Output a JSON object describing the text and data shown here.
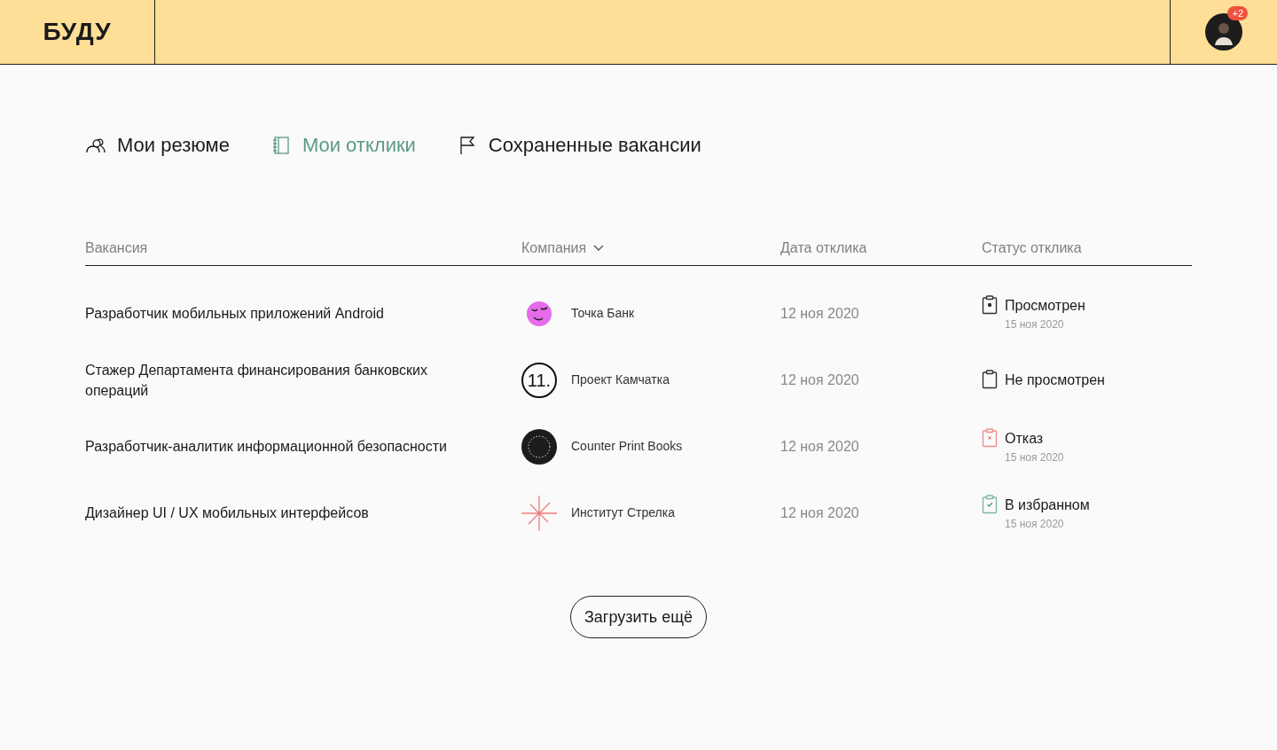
{
  "header": {
    "logo": "БУДУ",
    "avatar": {
      "badge": "+2"
    }
  },
  "tabs": [
    {
      "label": "Мои резюме",
      "kind": "resume",
      "selected": false
    },
    {
      "label": "Мои отклики",
      "kind": "responses",
      "selected": true
    },
    {
      "label": "Сохраненные вакансии",
      "kind": "saved",
      "selected": false
    }
  ],
  "table": {
    "columns": [
      {
        "label": "Вакансия",
        "kind": "plain"
      },
      {
        "label": "Компания",
        "kind": "sortable"
      },
      {
        "label": "Дата отклика",
        "kind": "plain"
      },
      {
        "label": "Статус отклика",
        "kind": "plain"
      }
    ],
    "rows": [
      {
        "vacancy": "Разработчик мобильных приложений Android",
        "company": {
          "name": "Точка Банк",
          "logo": {
            "kind": "face"
          }
        },
        "date": "12 ноя 2020",
        "status": {
          "label": "Просмотрен",
          "kind": "viewed",
          "date": "15 ноя 2020"
        }
      },
      {
        "vacancy": "Стажер Департамента финансирования банковских операций",
        "company": {
          "name": "Проект Камчатка",
          "logo": {
            "kind": "number",
            "text": "11."
          }
        },
        "date": "12 ноя 2020",
        "status": {
          "label": "Не просмотрен",
          "kind": "unviewed"
        }
      },
      {
        "vacancy": "Разработчик-аналитик информационной безопасности",
        "company": {
          "name": "Counter Print Books",
          "logo": {
            "kind": "ring"
          }
        },
        "date": "12 ноя 2020",
        "status": {
          "label": "Отказ",
          "kind": "rejected",
          "date": "15 ноя 2020"
        }
      },
      {
        "vacancy": "Дизайнер UI / UX мобильных интерфейсов",
        "company": {
          "name": "Институт Стрелка",
          "logo": {
            "kind": "star"
          }
        },
        "date": "12 ноя 2020",
        "status": {
          "label": "В избранном",
          "kind": "favorite",
          "date": "15 ноя 2020"
        }
      }
    ]
  },
  "load_more": "Загрузить ещё"
}
